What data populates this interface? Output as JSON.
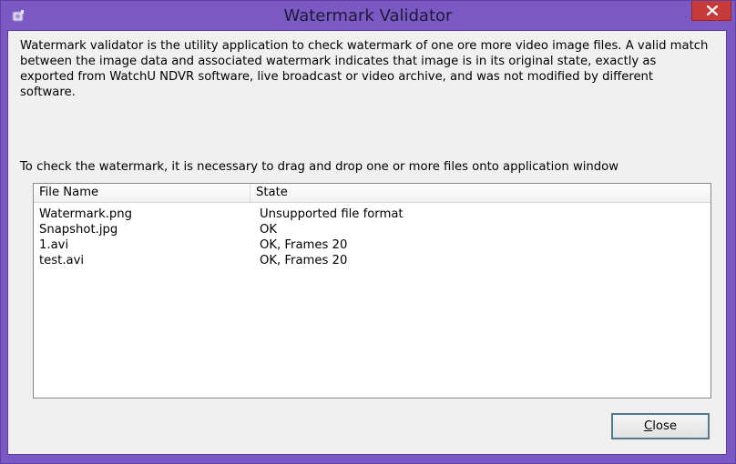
{
  "window": {
    "title": "Watermark Validator"
  },
  "description": "Watermark validator is the utility application to check watermark of one ore more video image files. A valid match between the image data and associated watermark indicates that image is in its original state, exactly as exported from WatchU NDVR software, live broadcast or video archive, and was not modified by different software.",
  "instruction": "To check the watermark, it is necessary to drag and drop one or more files onto application window",
  "table": {
    "columns": [
      "File Name",
      "State"
    ],
    "rows": [
      {
        "file": "Watermark.png",
        "state": "Unsupported file format"
      },
      {
        "file": "Snapshot.jpg",
        "state": "OK"
      },
      {
        "file": "1.avi",
        "state": "OK, Frames 20"
      },
      {
        "file": "test.avi",
        "state": "OK, Frames 20"
      }
    ]
  },
  "buttons": {
    "close_mnemonic": "C",
    "close_rest": "lose"
  },
  "icons": {
    "app": "app-icon",
    "close": "close-icon"
  },
  "colors": {
    "frame": "#7b59c4",
    "close_button": "#c73a3a",
    "client_bg": "#f0f0f0"
  }
}
